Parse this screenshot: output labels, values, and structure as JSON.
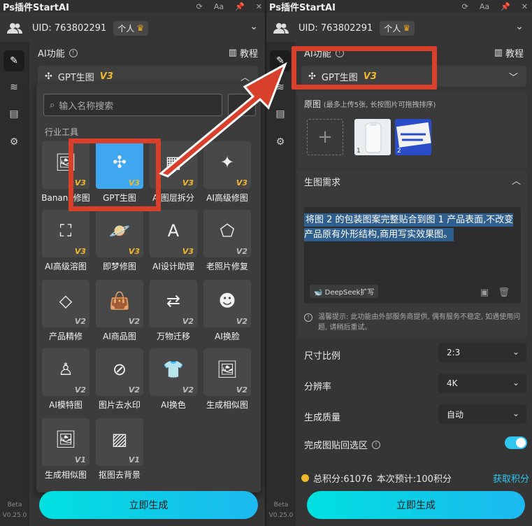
{
  "app": {
    "title": "Ps插件StartAI"
  },
  "user": {
    "uid_label": "UID:",
    "uid_value": "763802291",
    "plan": "个人"
  },
  "sidebar": {
    "beta": "Beta",
    "version": "V0.25.0"
  },
  "section": {
    "title": "AI功能",
    "tutorial": "教程"
  },
  "selector": {
    "label": "GPT生图",
    "version": "V3"
  },
  "dropdown": {
    "search_placeholder": "输入名称搜索",
    "category": "行业工具",
    "tools": [
      {
        "label": "Banana修图",
        "version": "V3",
        "icon": "image-icon"
      },
      {
        "label": "GPT生图",
        "version": "V3",
        "icon": "gpt-icon",
        "selected": true
      },
      {
        "label": "AI图层拆分",
        "version": "V3",
        "icon": "layers-split-icon"
      },
      {
        "label": "AI高级修图",
        "version": "V3",
        "icon": "magic-wand-icon"
      },
      {
        "label": "AI高级溶图",
        "version": "V3",
        "icon": "sparkle-image-icon"
      },
      {
        "label": "即梦修图",
        "version": "V3",
        "icon": "planet-icon"
      },
      {
        "label": "AI设计助理",
        "version": "V3",
        "icon": "design-assistant-icon"
      },
      {
        "label": "老照片修复",
        "version": "V2",
        "icon": "brush-repair-icon"
      },
      {
        "label": "产品精修",
        "version": "V2",
        "icon": "diamond-icon"
      },
      {
        "label": "AI商品图",
        "version": "V2",
        "icon": "shopping-bag-icon"
      },
      {
        "label": "万物迁移",
        "version": "V2",
        "icon": "transfer-icon"
      },
      {
        "label": "AI换脸",
        "version": "V2",
        "icon": "face-icon"
      },
      {
        "label": "AI模特图",
        "version": "V2",
        "icon": "model-icon"
      },
      {
        "label": "图片去水印",
        "version": "V2",
        "icon": "no-watermark-icon"
      },
      {
        "label": "AI换色",
        "version": "V2",
        "icon": "recolor-icon"
      },
      {
        "label": "生成相似图",
        "version": "V2",
        "icon": "similar-image-icon"
      },
      {
        "label": "生成相似图",
        "version": "V1",
        "icon": "similar-image-icon"
      },
      {
        "label": "抠图去背景",
        "version": "V1",
        "icon": "cutout-icon"
      }
    ]
  },
  "generate": {
    "label": "立即生成"
  },
  "right": {
    "original": {
      "title": "原图",
      "hint": "(最多上传5张, 长按图片可拖拽排序)",
      "thumbs": [
        "1",
        "2"
      ]
    },
    "prompt": {
      "title": "生图需求",
      "text": "将图 2 的包装图案完整贴合到图 1 产品表面,不改变产品原有外形结构,商用写实效果图。",
      "deepseek": "DeepSeek扩写"
    },
    "notice": "温馨提示: 此功能由外部服务商提供, 偶有服务不稳定, 如遇使用问题, 请稍后重试。",
    "options": {
      "ratio_label": "尺寸比例",
      "ratio_value": "2:3",
      "resolution_label": "分辨率",
      "resolution_value": "4K",
      "quality_label": "生成质量",
      "quality_value": "自动",
      "paste_label": "完成图贴回选区"
    },
    "credits": {
      "total": "总积分:61076",
      "estimate": "本次预计:100积分",
      "get": "获取积分"
    }
  },
  "colors": {
    "accent": "#2fc6f0",
    "highlight_box": "#d9402b",
    "version_gold": "#f0b92c",
    "selected_tile": "#3fa6f0"
  }
}
